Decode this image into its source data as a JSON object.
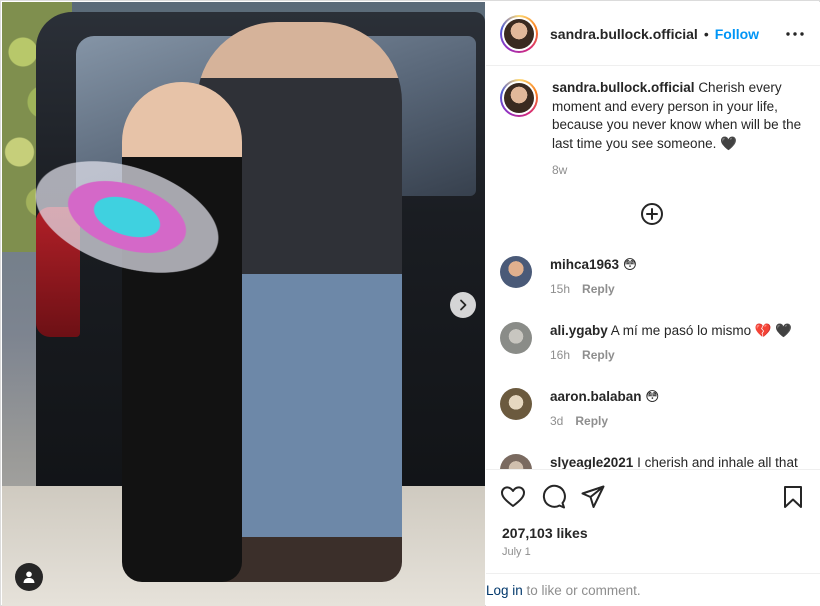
{
  "post": {
    "username": "sandra.bullock.official",
    "separator": "•",
    "follow_label": "Follow",
    "caption": "Cherish every moment and every person in your life, because you never know when will be the last time you see someone. 🖤",
    "caption_age": "8w"
  },
  "comments": [
    {
      "username": "mihca1963",
      "text": "😳",
      "age": "15h",
      "reply_label": "Reply",
      "avatar_color": "#4a5a78"
    },
    {
      "username": "ali.ygaby",
      "text": "A mí me pasó lo mismo 💔 🖤",
      "age": "16h",
      "reply_label": "Reply",
      "avatar_color": "#a8aaa6"
    },
    {
      "username": "aaron.balaban",
      "text": "😳",
      "age": "3d",
      "reply_label": "Reply",
      "avatar_color": "#6b5a3e"
    },
    {
      "username": "slyeagle2021",
      "text": "I cherish and inhale all that",
      "age": "",
      "reply_label": "",
      "avatar_color": "#7a6a60"
    }
  ],
  "actions": {
    "likes": "207,103 likes",
    "date": "July 1"
  },
  "footer": {
    "login_link": "Log in",
    "login_rest": " to like or comment."
  },
  "colors": {
    "accent": "#0095f6",
    "text": "#262626",
    "muted": "#8e8e8e",
    "link_dark": "#00376b"
  }
}
